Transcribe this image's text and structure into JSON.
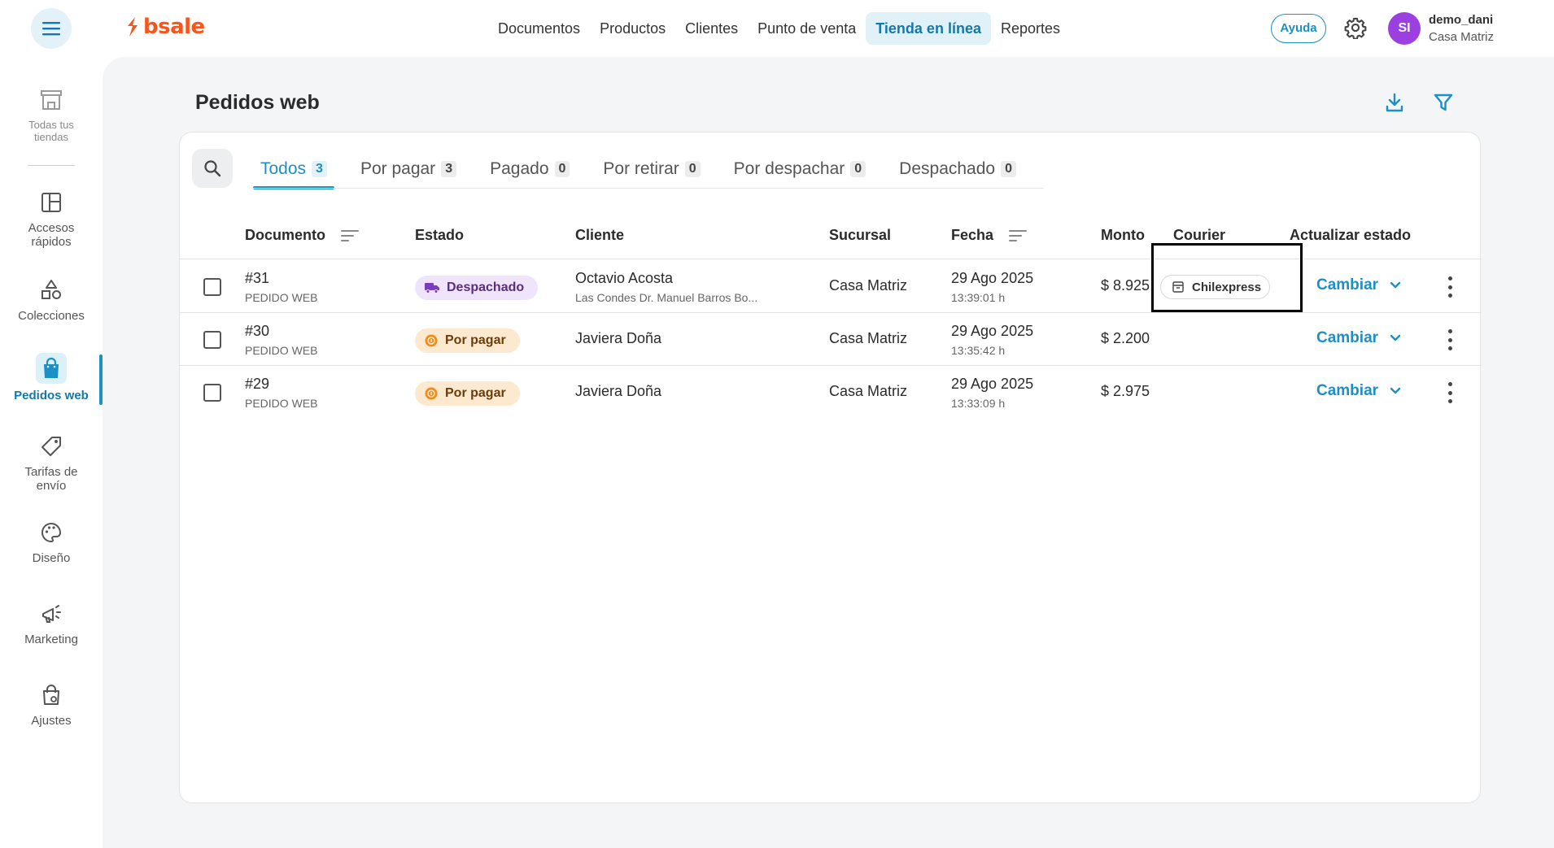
{
  "brand": {
    "name": "bsale",
    "color": "#f4561c"
  },
  "topnav": {
    "items": [
      {
        "label": "Documentos"
      },
      {
        "label": "Productos"
      },
      {
        "label": "Clientes"
      },
      {
        "label": "Punto de venta"
      },
      {
        "label": "Tienda en línea",
        "active": true
      },
      {
        "label": "Reportes"
      }
    ]
  },
  "header": {
    "help_label": "Ayuda",
    "avatar_initials": "SI",
    "user_name": "demo_dani",
    "user_branch": "Casa Matriz"
  },
  "sidebar": {
    "items": [
      {
        "label": "Todas tus tiendas",
        "icon": "store-icon"
      },
      {
        "label": "Accesos rápidos",
        "icon": "layout-icon"
      },
      {
        "label": "Colecciones",
        "icon": "shapes-icon"
      },
      {
        "label": "Pedidos web",
        "icon": "shopping-bag-icon",
        "active": true
      },
      {
        "label": "Tarifas de envío",
        "icon": "tag-icon"
      },
      {
        "label": "Diseño",
        "icon": "palette-icon"
      },
      {
        "label": "Marketing",
        "icon": "megaphone-icon"
      },
      {
        "label": "Ajustes",
        "icon": "settings-bag-icon"
      }
    ]
  },
  "page": {
    "title": "Pedidos web"
  },
  "tabs": [
    {
      "label": "Todos",
      "count": "3",
      "active": true
    },
    {
      "label": "Por pagar",
      "count": "3"
    },
    {
      "label": "Pagado",
      "count": "0"
    },
    {
      "label": "Por retirar",
      "count": "0"
    },
    {
      "label": "Por despachar",
      "count": "0"
    },
    {
      "label": "Despachado",
      "count": "0"
    }
  ],
  "table": {
    "headers": {
      "documento": "Documento",
      "estado": "Estado",
      "cliente": "Cliente",
      "sucursal": "Sucursal",
      "fecha": "Fecha",
      "monto": "Monto",
      "courier": "Courier",
      "actualizar": "Actualizar estado"
    },
    "rows": [
      {
        "doc_number": "#31",
        "doc_type": "PEDIDO WEB",
        "status": "Despachado",
        "client": "Octavio Acosta",
        "client_address": "Las Condes Dr. Manuel Barros Bo...",
        "branch": "Casa Matriz",
        "date": "29 Ago 2025",
        "time": "13:39:01 h",
        "amount": "$ 8.925",
        "courier": "Chilexpress",
        "action": "Cambiar"
      },
      {
        "doc_number": "#30",
        "doc_type": "PEDIDO WEB",
        "status": "Por pagar",
        "client": "Javiera Doña",
        "client_address": "",
        "branch": "Casa Matriz",
        "date": "29 Ago 2025",
        "time": "13:35:42 h",
        "amount": "$ 2.200",
        "courier": "",
        "action": "Cambiar"
      },
      {
        "doc_number": "#29",
        "doc_type": "PEDIDO WEB",
        "status": "Por pagar",
        "client": "Javiera Doña",
        "client_address": "",
        "branch": "Casa Matriz",
        "date": "29 Ago 2025",
        "time": "13:33:09 h",
        "amount": "$ 2.975",
        "courier": "",
        "action": "Cambiar"
      }
    ]
  },
  "colors": {
    "accent": "#1c8fc4",
    "status_dispatched_bg": "#efe4fb",
    "status_pending_bg": "#fde9cf",
    "avatar": "#9c3fe0"
  }
}
